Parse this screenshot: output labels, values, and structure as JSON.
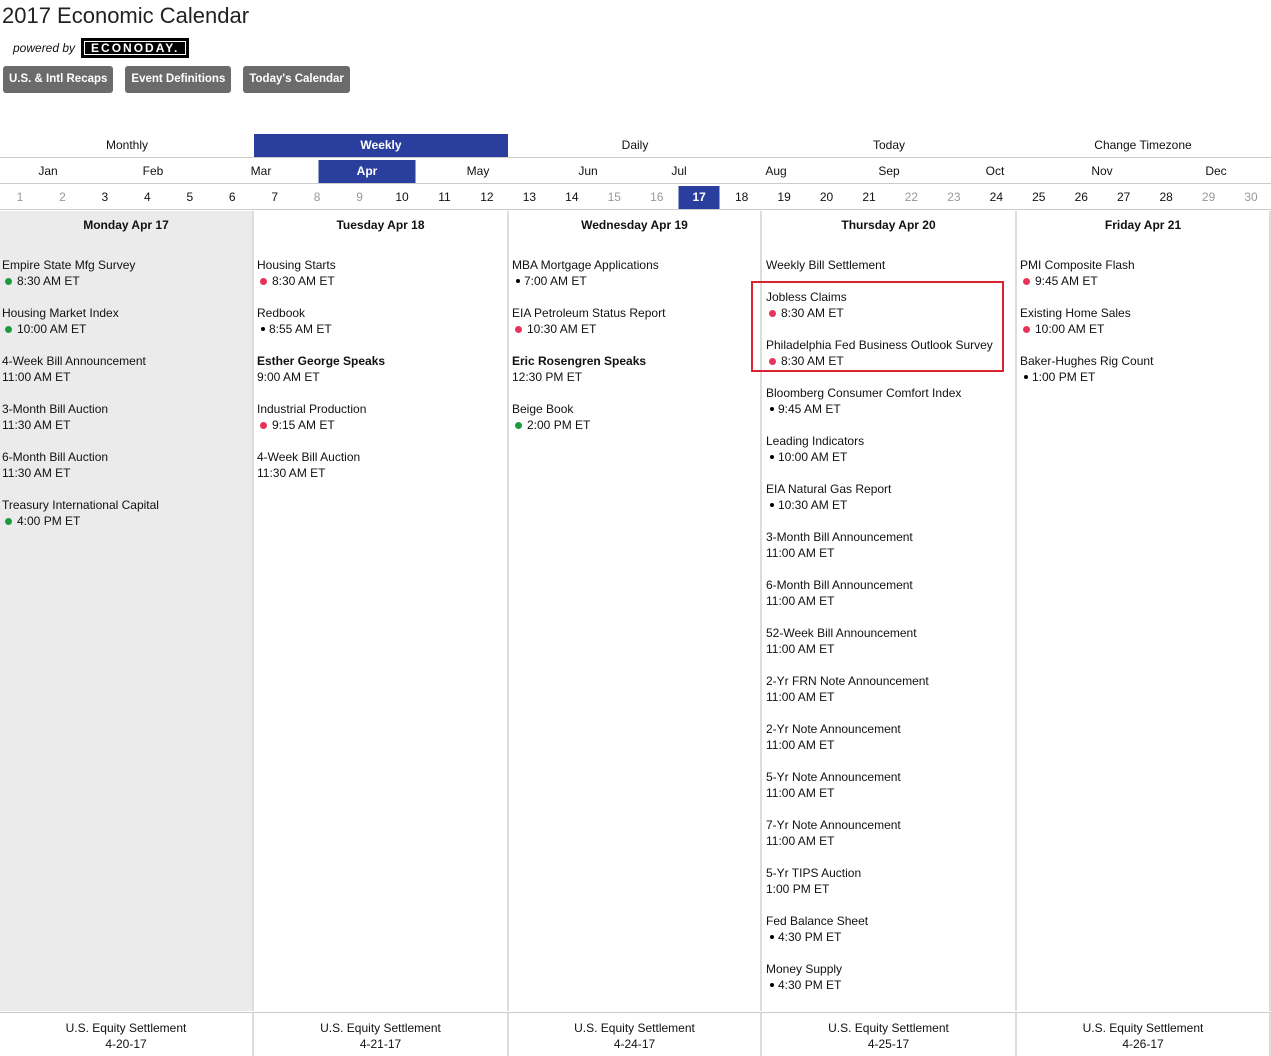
{
  "header": {
    "title": "2017 Economic Calendar",
    "powered_by": "powered by",
    "logo_text": "ECONODAY."
  },
  "top_buttons": [
    "U.S. & Intl Recaps",
    "Event Definitions",
    "Today's Calendar"
  ],
  "view_tabs": [
    {
      "label": "Monthly",
      "active": false
    },
    {
      "label": "Weekly",
      "active": true
    },
    {
      "label": "Daily",
      "active": false
    },
    {
      "label": "Today",
      "active": false
    },
    {
      "label": "Change Timezone",
      "active": false
    }
  ],
  "months": [
    {
      "label": "Jan",
      "active": false
    },
    {
      "label": "Feb",
      "active": false
    },
    {
      "label": "Mar",
      "active": false
    },
    {
      "label": "Apr",
      "active": true
    },
    {
      "label": "May",
      "active": false
    },
    {
      "label": "Jun",
      "active": false
    },
    {
      "label": "Jul",
      "active": false
    },
    {
      "label": "Aug",
      "active": false
    },
    {
      "label": "Sep",
      "active": false
    },
    {
      "label": "Oct",
      "active": false
    },
    {
      "label": "Nov",
      "active": false
    },
    {
      "label": "Dec",
      "active": false
    }
  ],
  "days": [
    {
      "n": "1",
      "weekend": true
    },
    {
      "n": "2",
      "weekend": true
    },
    {
      "n": "3"
    },
    {
      "n": "4"
    },
    {
      "n": "5"
    },
    {
      "n": "6"
    },
    {
      "n": "7"
    },
    {
      "n": "8",
      "weekend": true
    },
    {
      "n": "9",
      "weekend": true
    },
    {
      "n": "10"
    },
    {
      "n": "11"
    },
    {
      "n": "12"
    },
    {
      "n": "13"
    },
    {
      "n": "14"
    },
    {
      "n": "15",
      "weekend": true
    },
    {
      "n": "16",
      "weekend": true
    },
    {
      "n": "17",
      "active": true
    },
    {
      "n": "18"
    },
    {
      "n": "19"
    },
    {
      "n": "20"
    },
    {
      "n": "21"
    },
    {
      "n": "22",
      "weekend": true
    },
    {
      "n": "23",
      "weekend": true
    },
    {
      "n": "24"
    },
    {
      "n": "25"
    },
    {
      "n": "26"
    },
    {
      "n": "27"
    },
    {
      "n": "28"
    },
    {
      "n": "29",
      "weekend": true
    },
    {
      "n": "30",
      "weekend": true
    }
  ],
  "colors": {
    "accent": "#2a3f9d",
    "button_gray": "#6b6b6b",
    "dot_green": "#1e9b3c",
    "dot_red": "#e8335a",
    "highlight": "#d9232e"
  },
  "columns": [
    {
      "heading": "Monday Apr 17",
      "shaded": true,
      "events": [
        {
          "name": "Empire State Mfg Survey",
          "time": "8:30 AM ET",
          "dot": "green"
        },
        {
          "name": "Housing Market Index",
          "time": "10:00 AM ET",
          "dot": "green"
        },
        {
          "name": "4-Week Bill Announcement",
          "time": "11:00 AM ET",
          "dot": ""
        },
        {
          "name": "3-Month Bill Auction",
          "time": "11:30 AM ET",
          "dot": ""
        },
        {
          "name": "6-Month Bill Auction",
          "time": "11:30 AM ET",
          "dot": ""
        },
        {
          "name": "Treasury International Capital",
          "time": "4:00 PM ET",
          "dot": "green"
        }
      ],
      "footer": {
        "label": "U.S. Equity Settlement",
        "date": "4-20-17"
      }
    },
    {
      "heading": "Tuesday Apr 18",
      "shaded": false,
      "events": [
        {
          "name": "Housing Starts",
          "time": "8:30 AM ET",
          "dot": "red"
        },
        {
          "name": "Redbook",
          "time": "8:55 AM ET",
          "dot": "black"
        },
        {
          "name": "Esther George Speaks",
          "time": "9:00 AM ET",
          "dot": "",
          "bold": true
        },
        {
          "name": "Industrial Production",
          "time": "9:15 AM ET",
          "dot": "red"
        },
        {
          "name": "4-Week Bill Auction",
          "time": "11:30 AM ET",
          "dot": ""
        }
      ],
      "footer": {
        "label": "U.S. Equity Settlement",
        "date": "4-21-17"
      }
    },
    {
      "heading": "Wednesday Apr 19",
      "shaded": false,
      "events": [
        {
          "name": "MBA Mortgage Applications",
          "time": "7:00 AM ET",
          "dot": "black"
        },
        {
          "name": "EIA Petroleum Status Report",
          "time": "10:30 AM ET",
          "dot": "red"
        },
        {
          "name": "Eric Rosengren Speaks",
          "time": "12:30 PM ET",
          "dot": "",
          "bold": true
        },
        {
          "name": "Beige Book",
          "time": "2:00 PM ET",
          "dot": "green"
        }
      ],
      "footer": {
        "label": "U.S. Equity Settlement",
        "date": "4-24-17"
      }
    },
    {
      "heading": "Thursday Apr 20",
      "shaded": false,
      "events": [
        {
          "name": "Weekly Bill Settlement",
          "time": "",
          "dot": "",
          "short": true
        },
        {
          "name": "Jobless Claims",
          "time": "8:30 AM ET",
          "dot": "red"
        },
        {
          "name": "Philadelphia Fed Business Outlook Survey",
          "time": "8:30 AM ET",
          "dot": "red"
        },
        {
          "name": "Bloomberg Consumer Comfort Index",
          "time": "9:45 AM ET",
          "dot": "black"
        },
        {
          "name": "Leading Indicators",
          "time": "10:00 AM ET",
          "dot": "black"
        },
        {
          "name": "EIA Natural Gas Report",
          "time": "10:30 AM ET",
          "dot": "black"
        },
        {
          "name": "3-Month Bill Announcement",
          "time": "11:00 AM ET",
          "dot": ""
        },
        {
          "name": "6-Month Bill Announcement",
          "time": "11:00 AM ET",
          "dot": ""
        },
        {
          "name": "52-Week Bill Announcement",
          "time": "11:00 AM ET",
          "dot": ""
        },
        {
          "name": "2-Yr FRN Note Announcement",
          "time": "11:00 AM ET",
          "dot": ""
        },
        {
          "name": "2-Yr Note Announcement",
          "time": "11:00 AM ET",
          "dot": ""
        },
        {
          "name": "5-Yr Note Announcement",
          "time": "11:00 AM ET",
          "dot": ""
        },
        {
          "name": "7-Yr Note Announcement",
          "time": "11:00 AM ET",
          "dot": ""
        },
        {
          "name": "5-Yr TIPS Auction",
          "time": "1:00 PM ET",
          "dot": ""
        },
        {
          "name": "Fed Balance Sheet",
          "time": "4:30 PM ET",
          "dot": "black"
        },
        {
          "name": "Money Supply",
          "time": "4:30 PM ET",
          "dot": "black"
        }
      ],
      "footer": {
        "label": "U.S. Equity Settlement",
        "date": "4-25-17"
      }
    },
    {
      "heading": "Friday Apr 21",
      "shaded": false,
      "events": [
        {
          "name": "PMI Composite Flash",
          "time": "9:45 AM ET",
          "dot": "red"
        },
        {
          "name": "Existing Home Sales",
          "time": "10:00 AM ET",
          "dot": "red"
        },
        {
          "name": "Baker-Hughes Rig Count",
          "time": "1:00 PM ET",
          "dot": "black"
        }
      ],
      "footer": {
        "label": "U.S. Equity Settlement",
        "date": "4-26-17"
      }
    }
  ]
}
